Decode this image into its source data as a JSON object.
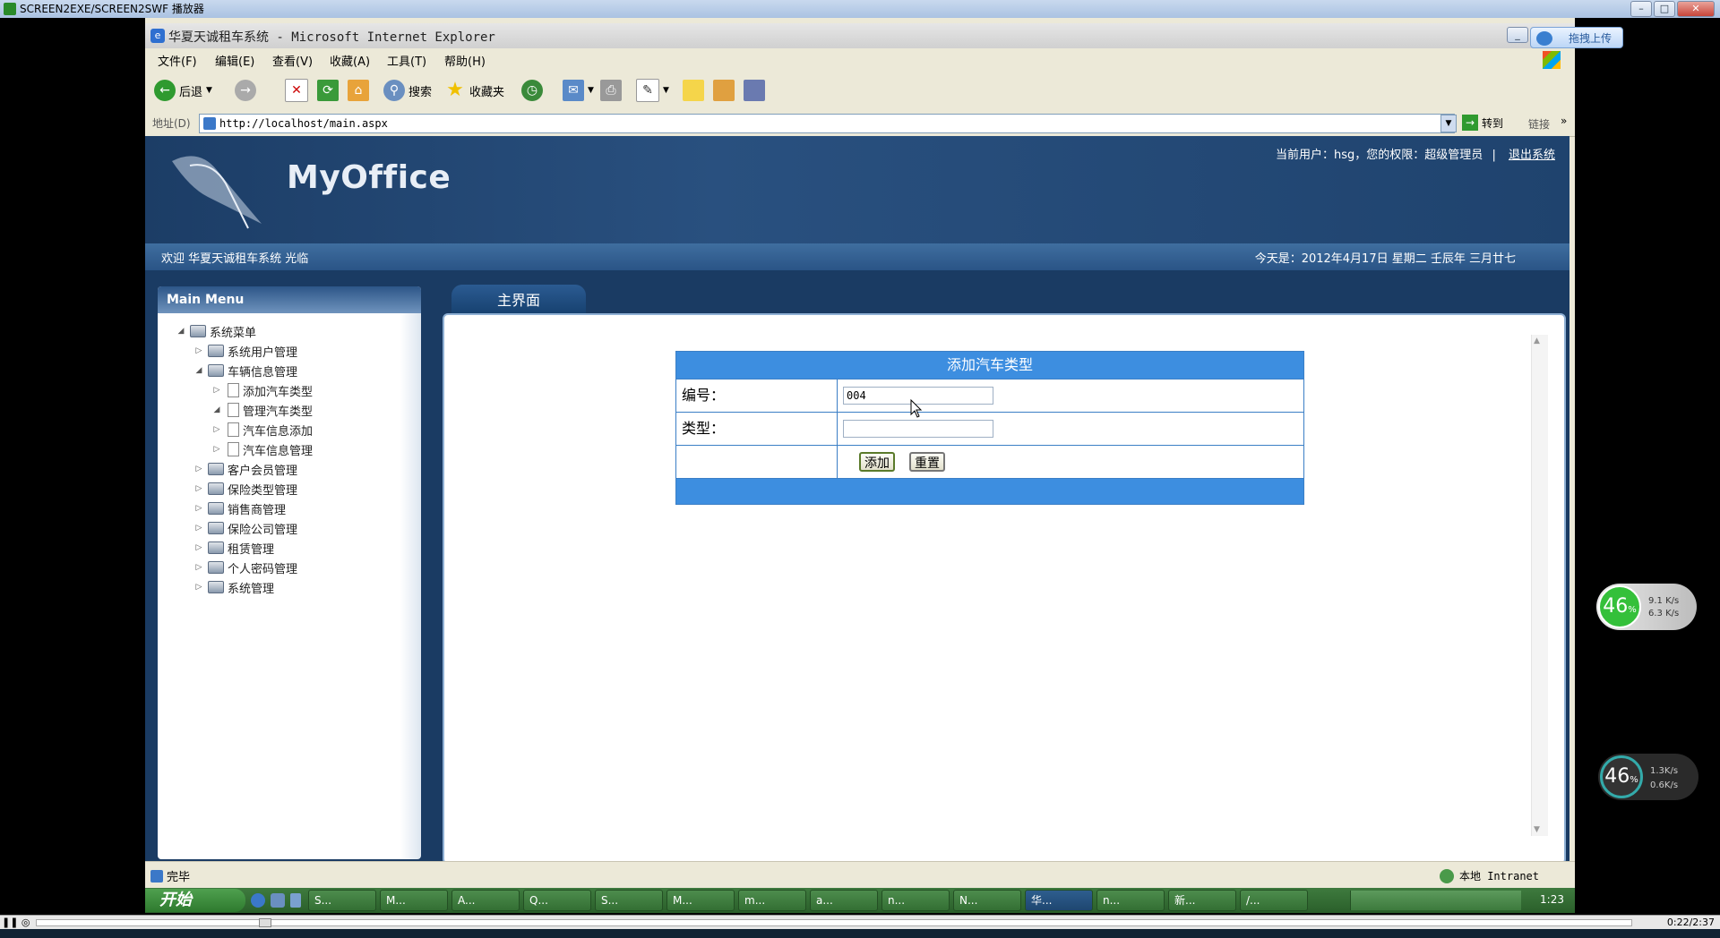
{
  "player": {
    "title": "SCREEN2EXE/SCREEN2SWF 播放器",
    "time": "0:22/2:37"
  },
  "browser": {
    "title": "华夏天诚租车系统 - Microsoft Internet Explorer",
    "menu": [
      "文件(F)",
      "编辑(E)",
      "查看(V)",
      "收藏(A)",
      "工具(T)",
      "帮助(H)"
    ],
    "toolbar": {
      "back": "后退",
      "search": "搜索",
      "favorites": "收藏夹"
    },
    "address_label": "地址(D)",
    "address": "http://localhost/main.aspx",
    "go": "转到",
    "links": "链接",
    "status": "完毕",
    "zone": "本地 Intranet"
  },
  "upload_button": "拖拽上传",
  "site": {
    "logo": "MyOffice",
    "user_info": "当前用户：hsg，您的权限：超级管理员",
    "logout": "退出系统",
    "welcome": "欢迎 华夏天诚租车系统 光临",
    "today": "今天是：2012年4月17日 星期二 壬辰年 三月廿七"
  },
  "sidebar": {
    "title": "Main Menu",
    "root": "系统菜单",
    "items": [
      {
        "label": "系统用户管理",
        "level": 1,
        "expanded": false
      },
      {
        "label": "车辆信息管理",
        "level": 1,
        "expanded": true
      },
      {
        "label": "添加汽车类型",
        "level": 2,
        "expanded": false
      },
      {
        "label": "管理汽车类型",
        "level": 2,
        "expanded": true
      },
      {
        "label": "汽车信息添加",
        "level": 2,
        "expanded": false
      },
      {
        "label": "汽车信息管理",
        "level": 2,
        "expanded": false
      },
      {
        "label": "客户会员管理",
        "level": 1,
        "expanded": false
      },
      {
        "label": "保险类型管理",
        "level": 1,
        "expanded": false
      },
      {
        "label": "销售商管理",
        "level": 1,
        "expanded": false
      },
      {
        "label": "保险公司管理",
        "level": 1,
        "expanded": false
      },
      {
        "label": "租赁管理",
        "level": 1,
        "expanded": false
      },
      {
        "label": "个人密码管理",
        "level": 1,
        "expanded": false
      },
      {
        "label": "系统管理",
        "level": 1,
        "expanded": false
      }
    ]
  },
  "main": {
    "tab": "主界面",
    "form": {
      "title": "添加汽车类型",
      "id_label": "编号：",
      "id_value": "004",
      "type_label": "类型：",
      "type_value": "",
      "add": "添加",
      "reset": "重置"
    }
  },
  "taskbar": {
    "start": "开始",
    "tasks": [
      "S...",
      "M...",
      "A...",
      "Q...",
      "S...",
      "M...",
      "m...",
      "a...",
      "n...",
      "N...",
      "华...",
      "n...",
      "新...",
      "/..."
    ],
    "active_index": 10,
    "clock": "1:23"
  },
  "net_monitor": [
    {
      "percent": "46",
      "up": "9.1 K/s",
      "down": "6.3 K/s"
    },
    {
      "percent": "46",
      "up": "1.3K/s",
      "down": "0.6K/s"
    }
  ]
}
